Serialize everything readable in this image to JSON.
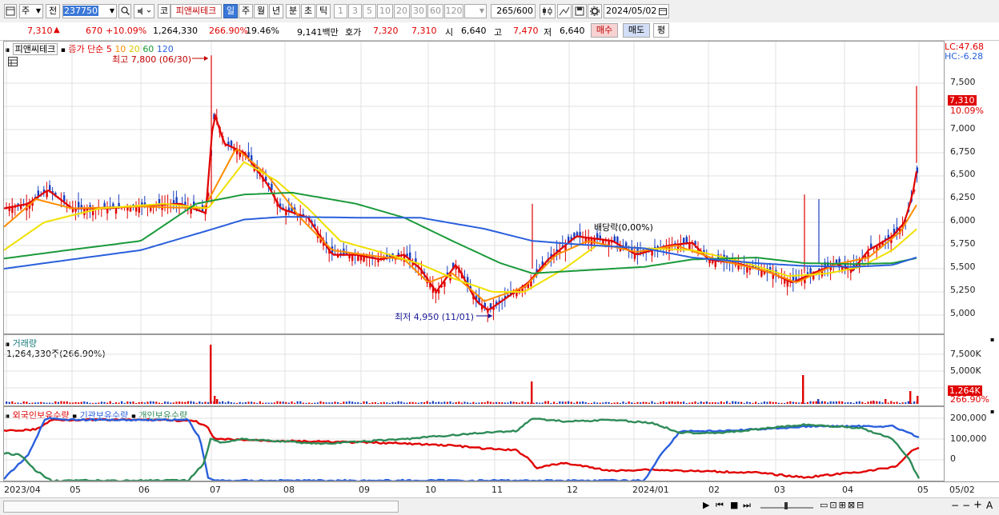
{
  "toolbar": {
    "period_select": "주",
    "prev_label": "전",
    "code": "237750",
    "code_type": "코",
    "stock_name": "피앤씨테크",
    "periods": [
      "일",
      "주",
      "월",
      "년",
      "분",
      "초",
      "틱"
    ],
    "active_period": "일",
    "numbers": [
      "1",
      "3",
      "5",
      "10",
      "20",
      "30",
      "60",
      "120"
    ],
    "count": "265",
    "count_total": "/600",
    "date": "2024/05/02"
  },
  "info": {
    "price": "7,310",
    "change": "670",
    "change_pct": "+10.09%",
    "volume": "1,264,330",
    "volume_ratio": "266.90%",
    "turnover": "19.46%",
    "amount": "9,141백만",
    "hoga_label": "호가",
    "hoga1": "7,320",
    "hoga2": "7,310",
    "open_label": "시",
    "open": "6,640",
    "high_label": "고",
    "high": "7,470",
    "low_label": "저",
    "low": "6,640",
    "buy": "매수",
    "sell": "매도",
    "avg": "평"
  },
  "price_pane": {
    "legend_name": "피앤씨테크",
    "legend_ma_title": "종가 단순",
    "ma_periods": [
      "5",
      "10",
      "20",
      "60",
      "120"
    ],
    "ma_colors": [
      "#e00000",
      "#ff8c00",
      "#f0e000",
      "#1a9a3a",
      "#2a5fdc"
    ],
    "max_label": "최고 7,800 (06/30)",
    "min_label": "최저 4,950 (11/01)",
    "dividend_label": "배당락(0,00%)",
    "lc": "LC:47.68",
    "hc": "HC:-6.28",
    "last_price": "7,310",
    "last_pct": "10.09%",
    "y_ticks": [
      "7,500",
      "7,000",
      "6,750",
      "6,500",
      "6,250",
      "6,000",
      "5,750",
      "5,500",
      "5,250",
      "5,000"
    ]
  },
  "volume_pane": {
    "title": "거래량",
    "value": "1,264,330주(266.90%)",
    "y_ticks": [
      "7,500K",
      "5,000K"
    ],
    "last": "1,264K",
    "last_pct": "266.90%"
  },
  "holding_pane": {
    "legend": [
      "외국인보유수량",
      "기관보유수량",
      "개인보유수량"
    ],
    "colors": [
      "#e00000",
      "#2a5fdc",
      "#2e8b57"
    ],
    "y_ticks": [
      "200,000",
      "100,000",
      "0"
    ]
  },
  "x_axis": [
    "2023/04",
    "05",
    "06",
    "07",
    "08",
    "09",
    "10",
    "11",
    "12",
    "2024/01",
    "02",
    "03",
    "04",
    "05"
  ],
  "x_end": "05/02",
  "chart_data": {
    "type": "line",
    "title": "피앤씨테크",
    "ylim": [
      4900,
      7800
    ],
    "x": [
      "2023/04",
      "2023/05",
      "2023/06",
      "2023/07",
      "2023/08",
      "2023/09",
      "2023/10",
      "2023/11",
      "2023/12",
      "2024/01",
      "2024/02",
      "2024/03",
      "2024/04",
      "2024/05"
    ],
    "series": [
      {
        "name": "5",
        "values": [
          6150,
          6200,
          6150,
          6850,
          6050,
          5600,
          5300,
          5150,
          5850,
          5750,
          5600,
          5350,
          5550,
          6550
        ]
      },
      {
        "name": "120",
        "values": [
          5500,
          5650,
          5750,
          5900,
          6050,
          6050,
          5950,
          5800,
          5700,
          5650,
          5550,
          5500,
          5500,
          5630
        ]
      }
    ]
  }
}
